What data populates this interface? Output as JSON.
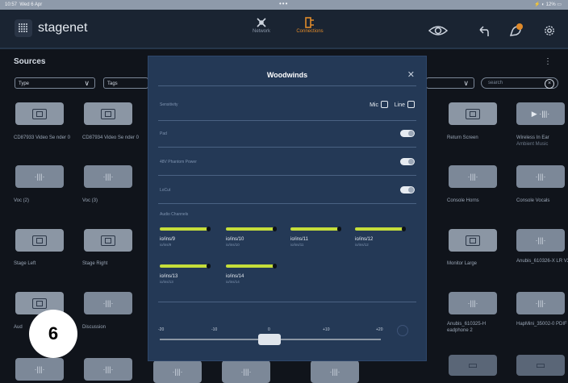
{
  "status": {
    "time": "10:57",
    "date": "Wed 6 Apr",
    "center": "•••",
    "battery": "12%"
  },
  "header": {
    "app_name": "stagenet",
    "tabs": [
      {
        "label": "Network"
      },
      {
        "label": "Connections"
      }
    ]
  },
  "sources": {
    "title": "Sources",
    "filter_type": "Type",
    "filter_tags": "Tags",
    "search_placeholder": "search"
  },
  "tiles": {
    "r1c1": "CD87933 Video Se nder 0",
    "r1c2": "CD87934 Video Se nder 0",
    "r1c7": "Return Screen",
    "r1c8": "Wireless In Ear",
    "r1c8_sub": "Ambient Music",
    "r2c1": "Voc (2)",
    "r2c2": "Voc (3)",
    "r2c7": "Console Horns",
    "r2c8": "Console Vocals",
    "r3c1": "Stage Left",
    "r3c2": "Stage Right",
    "r3c7": "Monitor Large",
    "r3c8": "Anubis_610326-X LR V2",
    "r4c1": "Aud",
    "r4c2": "Discussion",
    "r4c7": "Anubis_610325-H eadphone 2",
    "r4c8": "HapMini_35002-0 PDIF"
  },
  "dialog": {
    "title": "Woodwinds",
    "sensitivity_label": "Sensitivity",
    "mic_label": "Mic",
    "line_label": "Line",
    "pad_label": "Pad",
    "phantom_label": "48V Phantom Power",
    "locut_label": "LoCut",
    "audio_channels_label": "Audio Channels",
    "channels": [
      {
        "name": "io/ins/9",
        "path": "io/ins/9"
      },
      {
        "name": "io/ins/10",
        "path": "io/ins/10"
      },
      {
        "name": "io/ins/11",
        "path": "io/ins/11"
      },
      {
        "name": "io/ins/12",
        "path": "io/ins/12"
      },
      {
        "name": "io/ins/13",
        "path": "io/ins/13"
      },
      {
        "name": "io/ins/14",
        "path": "io/ins/14"
      }
    ],
    "gain_ticks": [
      "-20",
      "-10",
      "0",
      "+10",
      "+20"
    ],
    "gain_value": 0
  },
  "badge": "6",
  "colors": {
    "accent": "#e08a2a",
    "meter": "#c5de3a",
    "dialog_bg": "#243956"
  }
}
